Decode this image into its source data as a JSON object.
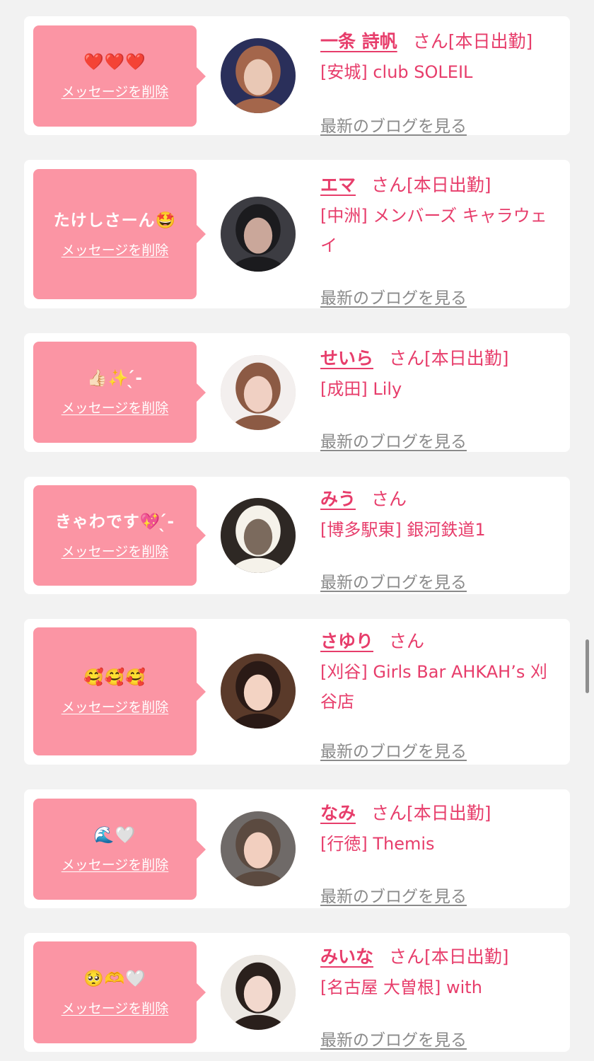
{
  "items": [
    {
      "message": "❤️❤️❤️",
      "delete_label": "メッセージを削除",
      "name": "一条 詩帆",
      "suffix": "さん[本日出勤]",
      "shop": "[安城] club SOLEIL",
      "blog_label": "最新のブログを見る",
      "avatar_colors": [
        "#2a2f5a",
        "#e9c8b5",
        "#a4664b"
      ]
    },
    {
      "message": "たけしさーん🤩",
      "delete_label": "メッセージを削除",
      "name": "エマ",
      "suffix": "さん[本日出勤]",
      "shop": "[中洲] メンバーズ キャラウェイ",
      "blog_label": "最新のブログを見る",
      "avatar_colors": [
        "#3c3c42",
        "#caa79a",
        "#1b1b1e"
      ]
    },
    {
      "message": "👍🏻✨ ̖́-",
      "delete_label": "メッセージを削除",
      "name": "せいら",
      "suffix": "さん[本日出勤]",
      "shop": "[成田] Lily",
      "blog_label": "最新のブログを見る",
      "avatar_colors": [
        "#f3efee",
        "#f0d0c3",
        "#8c5a44"
      ]
    },
    {
      "message": "きゃわです💖 ̖́-",
      "delete_label": "メッセージを削除",
      "name": "みう",
      "suffix": "さん",
      "shop": "[博多駅東] 銀河鉄道1",
      "blog_label": "最新のブログを見る",
      "avatar_colors": [
        "#2e2824",
        "#7b6a5d",
        "#f5f2ea"
      ]
    },
    {
      "message": "🥰🥰🥰",
      "delete_label": "メッセージを削除",
      "name": "さゆり",
      "suffix": "さん",
      "shop": "[刈谷] Girls Bar AHKAH’s 刈谷店",
      "blog_label": "最新のブログを見る",
      "avatar_colors": [
        "#5a3a2a",
        "#f3d3c3",
        "#2a1a16"
      ]
    },
    {
      "message": "🌊🤍",
      "delete_label": "メッセージを削除",
      "name": "なみ",
      "suffix": "さん[本日出勤]",
      "shop": "[行徳] Themis",
      "blog_label": "最新のブログを見る",
      "avatar_colors": [
        "#6f6a68",
        "#f2cfbf",
        "#5b4a40"
      ]
    },
    {
      "message": "🥺🫶🤍",
      "delete_label": "メッセージを削除",
      "name": "みいな",
      "suffix": "さん[本日出勤]",
      "shop": "[名古屋 大曽根] with",
      "blog_label": "最新のブログを見る",
      "avatar_colors": [
        "#ece8e3",
        "#f2d8cd",
        "#2a201c"
      ]
    }
  ],
  "colors": {
    "accent": "#e73d6b",
    "bubble": "#fb95a4",
    "link_gray": "#8a8a8a",
    "background": "#f2f2f2"
  }
}
